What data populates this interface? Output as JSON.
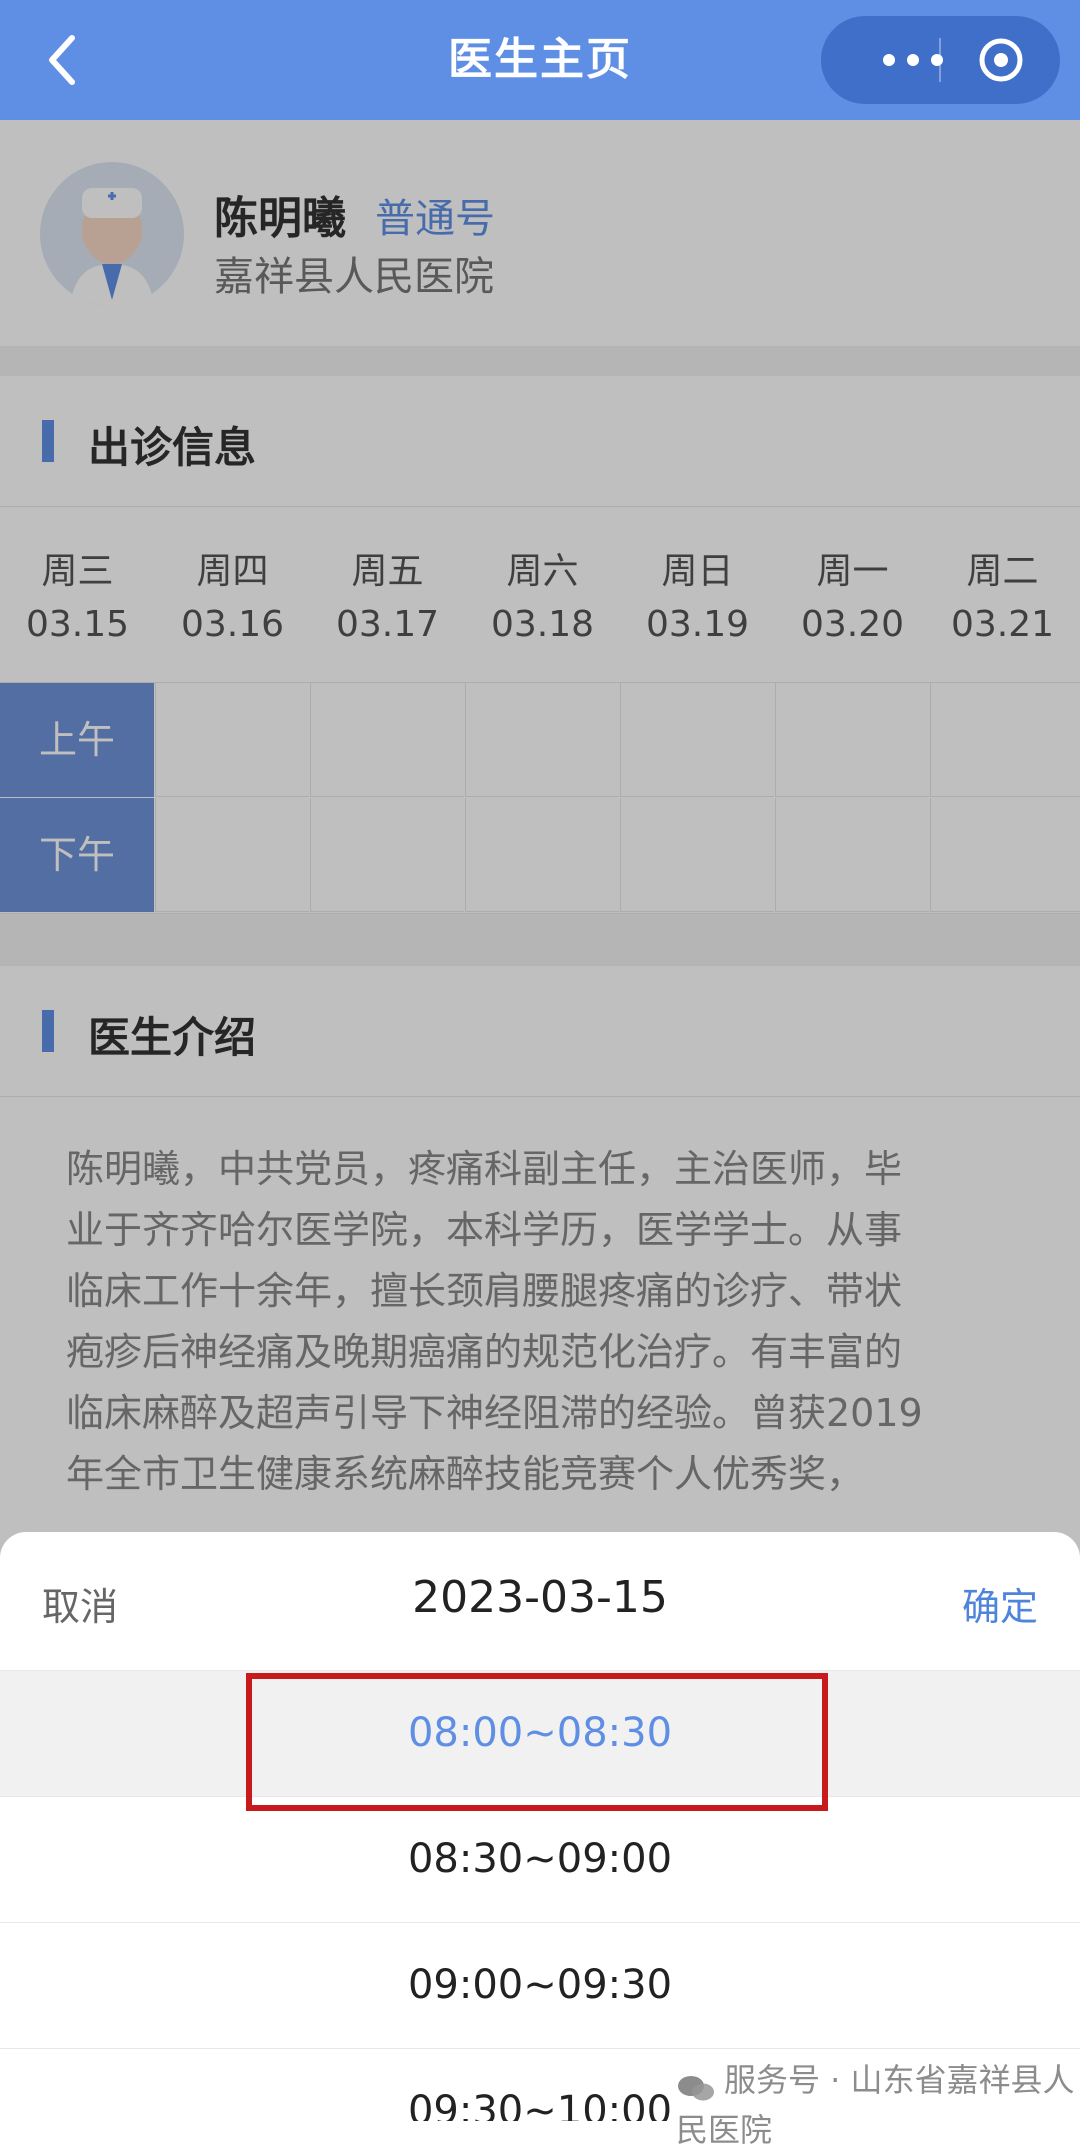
{
  "nav": {
    "title": "医生主页"
  },
  "doctor": {
    "name": "陈明曦",
    "type": "普通号",
    "hospital": "嘉祥县人民医院"
  },
  "schedule": {
    "section_title": "出诊信息",
    "days": [
      {
        "weekday": "周三",
        "date": "03.15"
      },
      {
        "weekday": "周四",
        "date": "03.16"
      },
      {
        "weekday": "周五",
        "date": "03.17"
      },
      {
        "weekday": "周六",
        "date": "03.18"
      },
      {
        "weekday": "周日",
        "date": "03.19"
      },
      {
        "weekday": "周一",
        "date": "03.20"
      },
      {
        "weekday": "周二",
        "date": "03.21"
      }
    ],
    "periods": [
      "上午",
      "下午"
    ]
  },
  "intro": {
    "section_title": "医生介绍",
    "lines": [
      "陈明曦，中共党员，疼痛科副主任，主治医师，毕",
      "业于齐齐哈尔医学院，本科学历，医学学士。从事",
      "临床工作十余年，擅长颈肩腰腿疼痛的诊疗、带状",
      "疱疹后神经痛及晚期癌痛的规范化治疗。有丰富的",
      "临床麻醉及超声引导下神经阻滞的经验。曾获2019",
      "年全市卫生健康系统麻醉技能竞赛个人优秀奖，"
    ]
  },
  "picker": {
    "cancel": "取消",
    "date": "2023-03-15",
    "confirm": "确定",
    "times": [
      "08:00~08:30",
      "08:30~09:00",
      "09:00~09:30",
      "09:30~10:00"
    ],
    "selected_index": 0
  },
  "watermark": {
    "text": "服务号 · 山东省嘉祥县人民医院"
  },
  "colors": {
    "primary": "#5f8fe4",
    "highlight_border": "#c8191d"
  }
}
